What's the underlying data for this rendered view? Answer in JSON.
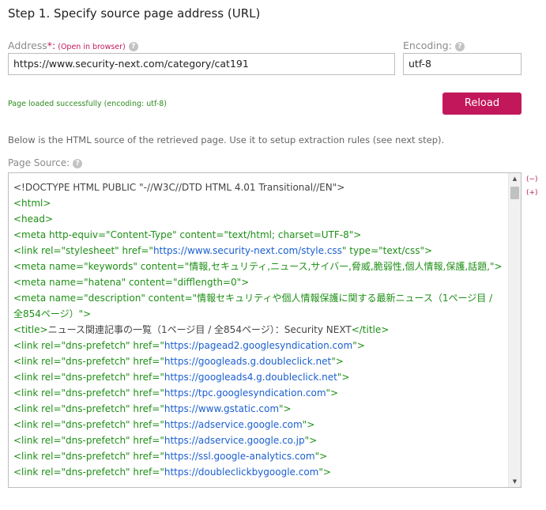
{
  "step": {
    "title": "Step 1. Specify source page address (URL)"
  },
  "address": {
    "label": "Address",
    "required_mark": "*:",
    "open_link": "(Open in browser)",
    "value": "https://www.security-next.com/category/cat191"
  },
  "encoding": {
    "label": "Encoding:",
    "value": "utf-8"
  },
  "status_text": "Page loaded successfully (encoding: utf-8)",
  "reload_label": "Reload",
  "description": "Below is the HTML source of the retrieved page. Use it to setup extraction rules (see next step).",
  "source": {
    "label": "Page Source:",
    "lines": [
      {
        "type": "doctype",
        "text": "<!DOCTYPE HTML PUBLIC \"-//W3C//DTD HTML 4.01 Transitional//EN\">"
      },
      {
        "type": "tag",
        "text": "<html>"
      },
      {
        "type": "tag",
        "text": "<head>"
      },
      {
        "type": "tag",
        "text": "<meta http-equiv=\"Content-Type\" content=\"text/html; charset=UTF-8\">"
      },
      {
        "type": "link",
        "pre": "<link rel=\"stylesheet\" href=\"",
        "url": "https://www.security-next.com/style.css",
        "post": "\" type=\"text/css\">"
      },
      {
        "type": "tag",
        "text": "<meta name=\"keywords\" content=\"情報,セキュリティ,ニュース,サイバー,脅威,脆弱性,個人情報,保護,話題,\">"
      },
      {
        "type": "tag",
        "text": "<meta name=\"hatena\" content=\"difflength=0\">"
      },
      {
        "type": "tag",
        "text": "<meta name=\"description\" content=\"情報セキュリティや個人情報保護に関する最新ニュース（1ページ目 / 全854ページ）\">"
      },
      {
        "type": "title",
        "open": "<title>",
        "text": "ニュース関連記事の一覧（1ページ目 / 全854ページ）：Security NEXT",
        "close": "</title>"
      },
      {
        "type": "link",
        "pre": "<link rel=\"dns-prefetch\" href=\"",
        "url": "https://pagead2.googlesyndication.com",
        "post": "\">"
      },
      {
        "type": "link",
        "pre": "<link rel=\"dns-prefetch\" href=\"",
        "url": "https://googleads.g.doubleclick.net",
        "post": "\">"
      },
      {
        "type": "link",
        "pre": "<link rel=\"dns-prefetch\" href=\"",
        "url": "https://googleads4.g.doubleclick.net",
        "post": "\">"
      },
      {
        "type": "link",
        "pre": "<link rel=\"dns-prefetch\" href=\"",
        "url": "https://tpc.googlesyndication.com",
        "post": "\">"
      },
      {
        "type": "link",
        "pre": "<link rel=\"dns-prefetch\" href=\"",
        "url": "https://www.gstatic.com",
        "post": "\">"
      },
      {
        "type": "link",
        "pre": "<link rel=\"dns-prefetch\" href=\"",
        "url": "https://adservice.google.com",
        "post": "\">"
      },
      {
        "type": "link",
        "pre": "<link rel=\"dns-prefetch\" href=\"",
        "url": "https://adservice.google.co.jp",
        "post": "\">"
      },
      {
        "type": "link",
        "pre": "<link rel=\"dns-prefetch\" href=\"",
        "url": "https://ssl.google-analytics.com",
        "post": "\">"
      },
      {
        "type": "link",
        "pre": "<link rel=\"dns-prefetch\" href=\"",
        "url": "https://doubleclickbygoogle.com",
        "post": "\">"
      }
    ]
  },
  "toggles": {
    "collapse": "(−)",
    "expand": "(+)"
  },
  "icons": {
    "help": "help-icon",
    "scroll_up": "scroll-up-icon",
    "scroll_down": "scroll-down-icon"
  },
  "colors": {
    "accent": "#c2185b",
    "success": "#2e8b1f",
    "tag": "#1e8f16",
    "url": "#1a5fd0"
  }
}
